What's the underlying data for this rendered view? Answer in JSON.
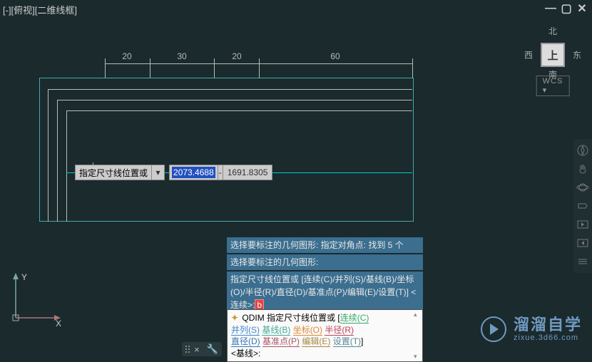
{
  "viewport_label": "[-][俯视][二维线框]",
  "window_controls": {
    "min": "—",
    "max": "▢",
    "close": "✕"
  },
  "viewcube": {
    "top": "北",
    "bottom": "南",
    "left": "西",
    "right": "东",
    "face": "上",
    "wcs": "WCS ▾"
  },
  "dimensions": {
    "d1": "20",
    "d2": "30",
    "d3": "20",
    "d4": "60"
  },
  "dynamic_input": {
    "label": "指定尺寸线位置或",
    "field1": "2073.4688",
    "sep": "-",
    "field2": "1691.8305"
  },
  "history": {
    "line1": "选择要标注的几何图形: 指定对角点: 找到 5 个",
    "line2": "选择要标注的几何图形:",
    "line3": "指定尺寸线位置或 [连续(C)/并列(S)/基线(B)/坐标(O)/半径(R)/直径(D)/基准点(P)/编辑(E)/设置(T)] <连续>:",
    "red_char": "b"
  },
  "cmdline": {
    "cmd": "QDIM",
    "prompt_pre": "指定尺寸线位置或 [",
    "opts": {
      "c": "连续(C)",
      "s": "并列(S)",
      "b": "基线(B)",
      "o": "坐标(O)",
      "r": "半径(R)",
      "d": "直径(D)",
      "p": "基准点(P)",
      "e": "编辑(E)",
      "t": "设置(T)"
    },
    "prompt_post": "]",
    "default": "<基线>:"
  },
  "ucs": {
    "x": "X",
    "y": "Y"
  },
  "watermark": {
    "big": "溜溜自学",
    "small": "zixue.3d66.com"
  },
  "icons": {
    "compass": "compass",
    "pan": "pan",
    "orbit": "orbit",
    "steering": "steering",
    "prev": "prev",
    "next": "next",
    "menu": "menu"
  }
}
